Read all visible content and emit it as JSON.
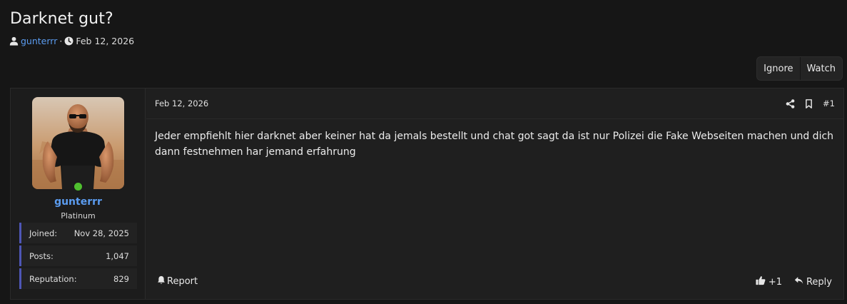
{
  "thread": {
    "title": "Darknet gut?",
    "author": "gunterrr",
    "separator": "·",
    "date": "Feb 12, 2026",
    "actions": {
      "ignore": "Ignore",
      "watch": "Watch"
    }
  },
  "post": {
    "date": "Feb 12, 2026",
    "number": "#1",
    "body": "Jeder empfiehlt hier darknet aber keiner hat da jemals bestellt und chat got sagt da ist nur Polizei die Fake Webseiten machen und dich dann festnehmen har jemand erfahrung",
    "report": "Report",
    "reaction_count": "+1",
    "reply": "Reply"
  },
  "user": {
    "name": "gunterrr",
    "title": "Platinum",
    "online": true,
    "stats": [
      {
        "label": "Joined:",
        "value": "Nov 28, 2025"
      },
      {
        "label": "Posts:",
        "value": "1,047"
      },
      {
        "label": "Reputation:",
        "value": "829"
      }
    ]
  },
  "icons": {
    "author": "user-icon",
    "time": "clock-icon",
    "share": "share-icon",
    "bookmark": "bookmark-icon",
    "report": "bell-icon",
    "like": "thumbs-up-icon",
    "reply": "reply-arrow-icon"
  },
  "colors": {
    "background": "#161616",
    "panel": "#1f1f1f",
    "link": "#5b9cf0",
    "online": "#4fbf2f",
    "stat_accent": "#4e56b6"
  }
}
